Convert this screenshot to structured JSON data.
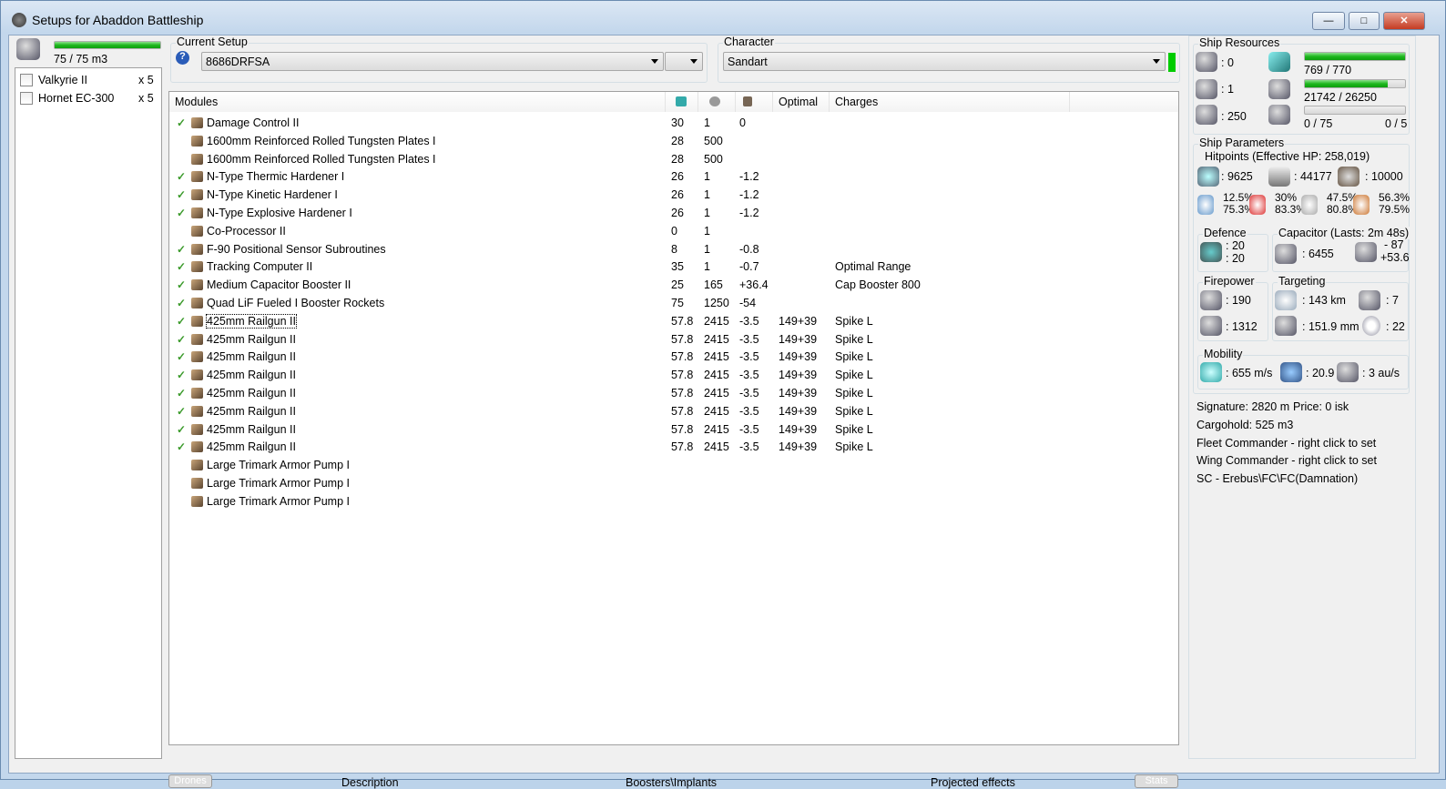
{
  "window": {
    "title": "Setups for Abaddon Battleship",
    "min": "—",
    "max": "□",
    "close": "✕"
  },
  "drones": {
    "bay": "75 / 75 m3",
    "bay_fill": 1.0,
    "items": [
      {
        "name": "Valkyrie II",
        "qty": "x 5"
      },
      {
        "name": "Hornet EC-300",
        "qty": "x 5"
      }
    ]
  },
  "setup": {
    "label": "Current Setup",
    "value": "8686DRFSA",
    "help": "?"
  },
  "character": {
    "label": "Character",
    "value": "Sandart"
  },
  "modules": {
    "columns": [
      "Modules",
      "",
      "",
      "",
      "Optimal",
      "Charges"
    ],
    "rows": [
      {
        "chk": "✓",
        "name": "Damage Control II",
        "cpu": "30",
        "pg": "1",
        "cap": "0",
        "opt": "",
        "charge": ""
      },
      {
        "chk": "",
        "name": "1600mm Reinforced Rolled Tungsten Plates I",
        "cpu": "28",
        "pg": "500",
        "cap": "",
        "opt": "",
        "charge": ""
      },
      {
        "chk": "",
        "name": "1600mm Reinforced Rolled Tungsten Plates I",
        "cpu": "28",
        "pg": "500",
        "cap": "",
        "opt": "",
        "charge": ""
      },
      {
        "chk": "✓",
        "name": "N-Type Thermic Hardener I",
        "cpu": "26",
        "pg": "1",
        "cap": "-1.2",
        "opt": "",
        "charge": ""
      },
      {
        "chk": "✓",
        "name": "N-Type Kinetic Hardener I",
        "cpu": "26",
        "pg": "1",
        "cap": "-1.2",
        "opt": "",
        "charge": ""
      },
      {
        "chk": "✓",
        "name": "N-Type Explosive Hardener I",
        "cpu": "26",
        "pg": "1",
        "cap": "-1.2",
        "opt": "",
        "charge": ""
      },
      {
        "chk": "",
        "name": "Co-Processor II",
        "cpu": "0",
        "pg": "1",
        "cap": "",
        "opt": "",
        "charge": ""
      },
      {
        "chk": "✓",
        "name": "F-90 Positional Sensor Subroutines",
        "cpu": "8",
        "pg": "1",
        "cap": "-0.8",
        "opt": "",
        "charge": ""
      },
      {
        "chk": "✓",
        "name": "Tracking Computer II",
        "cpu": "35",
        "pg": "1",
        "cap": "-0.7",
        "opt": "",
        "charge": "Optimal Range"
      },
      {
        "chk": "✓",
        "name": "Medium Capacitor Booster II",
        "cpu": "25",
        "pg": "165",
        "cap": "+36.4",
        "opt": "",
        "charge": "Cap Booster 800"
      },
      {
        "chk": "✓",
        "name": "Quad LiF Fueled I Booster Rockets",
        "cpu": "75",
        "pg": "1250",
        "cap": "-54",
        "opt": "",
        "charge": ""
      },
      {
        "chk": "✓",
        "name": "425mm Railgun II",
        "cpu": "57.8",
        "pg": "2415",
        "cap": "-3.5",
        "opt": "149+39",
        "charge": "Spike L"
      },
      {
        "chk": "✓",
        "name": "425mm Railgun II",
        "cpu": "57.8",
        "pg": "2415",
        "cap": "-3.5",
        "opt": "149+39",
        "charge": "Spike L"
      },
      {
        "chk": "✓",
        "name": "425mm Railgun II",
        "cpu": "57.8",
        "pg": "2415",
        "cap": "-3.5",
        "opt": "149+39",
        "charge": "Spike L"
      },
      {
        "chk": "✓",
        "name": "425mm Railgun II",
        "cpu": "57.8",
        "pg": "2415",
        "cap": "-3.5",
        "opt": "149+39",
        "charge": "Spike L"
      },
      {
        "chk": "✓",
        "name": "425mm Railgun II",
        "cpu": "57.8",
        "pg": "2415",
        "cap": "-3.5",
        "opt": "149+39",
        "charge": "Spike L"
      },
      {
        "chk": "✓",
        "name": "425mm Railgun II",
        "cpu": "57.8",
        "pg": "2415",
        "cap": "-3.5",
        "opt": "149+39",
        "charge": "Spike L"
      },
      {
        "chk": "✓",
        "name": "425mm Railgun II",
        "cpu": "57.8",
        "pg": "2415",
        "cap": "-3.5",
        "opt": "149+39",
        "charge": "Spike L"
      },
      {
        "chk": "✓",
        "name": "425mm Railgun II",
        "cpu": "57.8",
        "pg": "2415",
        "cap": "-3.5",
        "opt": "149+39",
        "charge": "Spike L"
      },
      {
        "chk": "",
        "name": "Large Trimark Armor Pump I",
        "cpu": "",
        "pg": "",
        "cap": "",
        "opt": "",
        "charge": ""
      },
      {
        "chk": "",
        "name": "Large Trimark Armor Pump I",
        "cpu": "",
        "pg": "",
        "cap": "",
        "opt": "",
        "charge": ""
      },
      {
        "chk": "",
        "name": "Large Trimark Armor Pump I",
        "cpu": "",
        "pg": "",
        "cap": "",
        "opt": "",
        "charge": ""
      }
    ]
  },
  "tabs": {
    "drones": "Drones",
    "description": "Description",
    "boosters": "Boosters\\Implants",
    "projected": "Projected effects",
    "stats": "Stats"
  },
  "resources": {
    "label": "Ship Resources",
    "turrets": ": 0",
    "launchers": ": 1",
    "drone_bay": ": 250",
    "cpu": "769 / 770",
    "cpu_fill": 0.999,
    "pg": "21742 / 26250",
    "pg_fill": 0.828,
    "bandwidth": "0 / 75",
    "bandwidth_fill": 0,
    "drones_active": "0 / 5"
  },
  "params": {
    "label": "Ship Parameters",
    "hp_label": "Hitpoints (Effective HP: 258,019)",
    "shield": ": 9625",
    "armor": ": 44177",
    "structure": ": 10000",
    "res": [
      [
        "12.5%",
        "75.3%"
      ],
      [
        "30%",
        "83.3%"
      ],
      [
        "47.5%",
        "80.8%"
      ],
      [
        "56.3%",
        "79.5%"
      ]
    ],
    "defence_label": "Defence",
    "defence": [
      ": 20",
      ": 20"
    ],
    "cap_label": "Capacitor (Lasts: 2m 48s)",
    "cap": ": 6455",
    "cap_use": "- 87",
    "cap_regen": "+53.6",
    "fire_label": "Firepower",
    "dps": ": 190",
    "volley": ": 1312",
    "targ_label": "Targeting",
    "range": ": 143 km",
    "targets": ": 7",
    "sig_res": ": 151.9 mm",
    "scan": ": 22",
    "mob_label": "Mobility",
    "speed": ": 655 m/s",
    "agility": ": 20.9",
    "warp": ": 3 au/s",
    "signature": "Signature: 2820 m",
    "price": "Price: 0 isk",
    "cargo": "Cargohold: 525 m3",
    "fleet": "Fleet Commander - right click to set",
    "wing": "Wing Commander - right click to set",
    "sc": "SC - Erebus\\FC\\FC(Damnation)"
  }
}
